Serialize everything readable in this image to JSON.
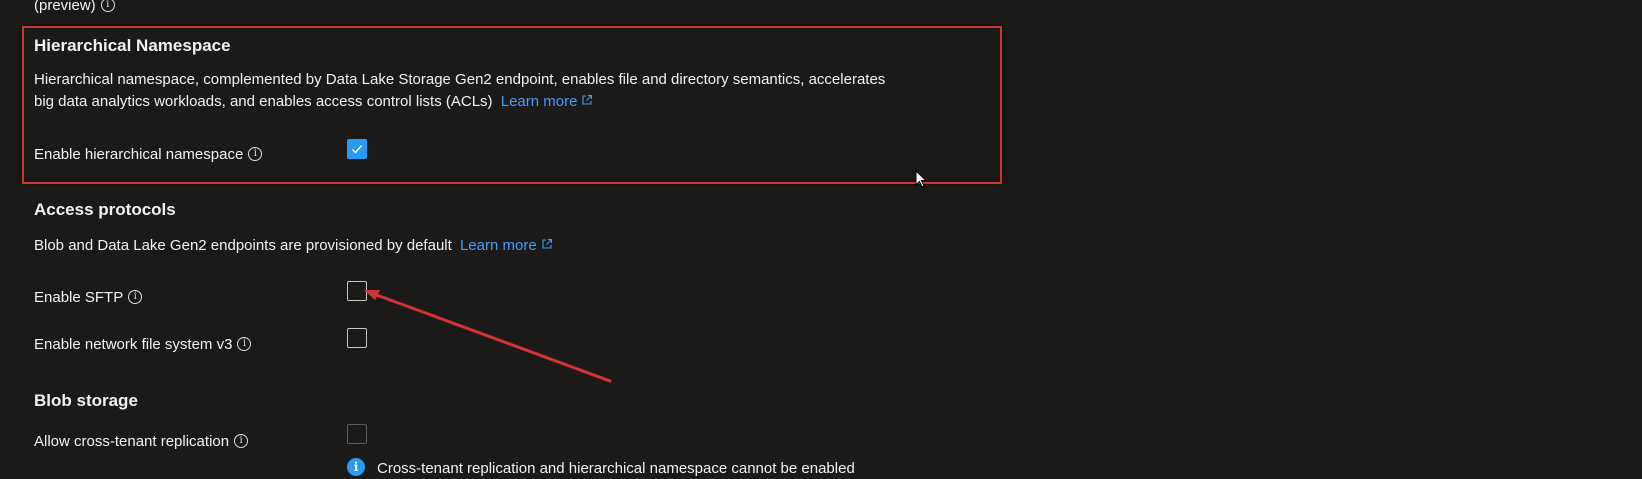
{
  "top": {
    "preview_label": "(preview)"
  },
  "hierarchical_namespace": {
    "heading": "Hierarchical Namespace",
    "description_line1": "Hierarchical namespace, complemented by Data Lake Storage Gen2 endpoint, enables file and directory semantics, accelerates",
    "description_line2": "big data analytics workloads, and enables access control lists (ACLs)",
    "learn_more": "Learn more",
    "enable_label": "Enable hierarchical namespace",
    "enable_checked": true
  },
  "access_protocols": {
    "heading": "Access protocols",
    "description": "Blob and Data Lake Gen2 endpoints are provisioned by default",
    "learn_more": "Learn more",
    "sftp_label": "Enable SFTP",
    "sftp_checked": false,
    "nfs_label": "Enable network file system v3",
    "nfs_checked": false
  },
  "blob_storage": {
    "heading": "Blob storage",
    "cross_tenant_label": "Allow cross-tenant replication",
    "cross_tenant_checked": false,
    "cross_tenant_disabled": true,
    "notice": "Cross-tenant replication and hierarchical namespace cannot be enabled"
  },
  "colors": {
    "background": "#1b1a19",
    "text": "#f3f2f1",
    "link": "#479ef5",
    "accent": "#2899f5",
    "highlight_border": "#d13438",
    "annotation_arrow": "#d13438"
  },
  "icons": {
    "info": "info-icon",
    "external_link": "external-link-icon",
    "checkmark": "checkmark-icon",
    "cursor": "mouse-cursor-icon",
    "notice_info": "info-filled-icon"
  }
}
